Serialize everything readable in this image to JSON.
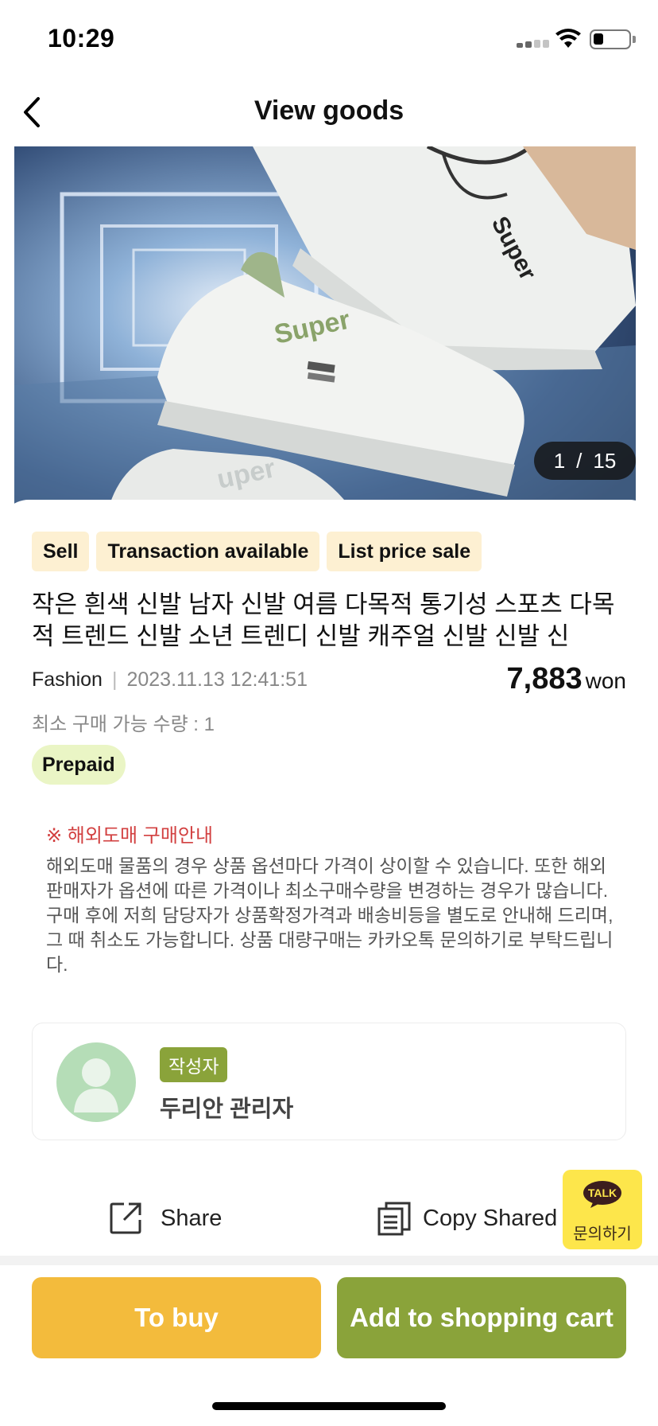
{
  "status_bar": {
    "time": "10:29"
  },
  "nav": {
    "title": "View goods"
  },
  "image": {
    "current": "1",
    "separator": "/",
    "total": "15"
  },
  "tags": [
    "Sell",
    "Transaction available",
    "List price sale"
  ],
  "product": {
    "title": "작은 흰색 신발 남자 신발 여름 다목적 통기성 스포츠 다목적 트렌드 신발 소년 트렌디 신발 캐주얼 신발 신발 신",
    "category": "Fashion",
    "separator": "|",
    "date": "2023.11.13 12:41:51",
    "price": "7,883",
    "price_unit": "won",
    "min_qty": "최소 구매 가능 수량 : 1",
    "payment_badge": "Prepaid"
  },
  "notice": {
    "title": "※ 해외도매 구매안내",
    "body": "해외도매 물품의 경우 상품 옵션마다 가격이 상이할 수 있습니다. 또한 해외 판매자가 옵션에 따른 가격이나 최소구매수량을 변경하는 경우가 많습니다. 구매 후에 저희 담당자가 상품확정가격과 배송비등을 별도로 안내해 드리며, 그 때 취소도 가능합니다. 상품 대량구매는 카카오톡 문의하기로 부탁드립니다."
  },
  "author": {
    "badge": "작성자",
    "name": "두리안 관리자"
  },
  "actions": {
    "share_label": "Share",
    "copy_label": "Copy Shared"
  },
  "talk": {
    "bubble_text": "TALK",
    "label": "문의하기"
  },
  "buttons": {
    "buy_label": "To buy",
    "cart_label": "Add to shopping cart"
  },
  "colors": {
    "accent_green": "#8aa33a",
    "accent_yellow": "#f3bb3c",
    "tag_bg": "#fdf0d2",
    "notice_red": "#d24040",
    "kakao_yellow": "#fde64b"
  }
}
